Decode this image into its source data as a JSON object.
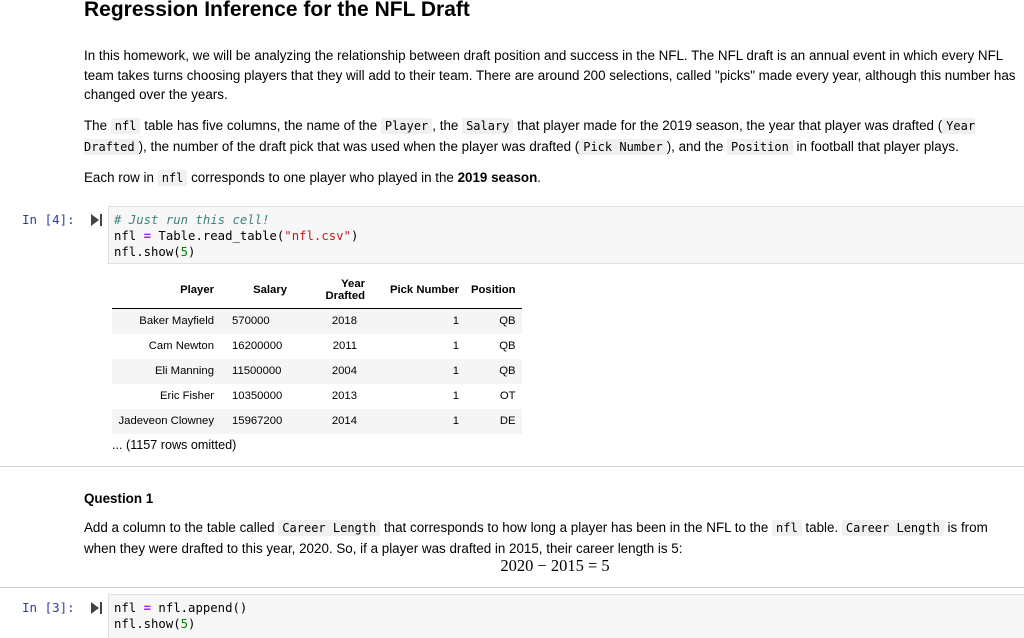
{
  "title": "Regression Inference for the NFL Draft",
  "intro": "In this homework, we will be analyzing the relationship between draft position and success in the NFL. The NFL draft is an annual event in which every NFL team takes turns choosing players that they will add to their team. There are around 200 selections, called \"picks\" made every year, although this number has changed over the years.",
  "para2": {
    "t1": "The ",
    "c1": "nfl",
    "t2": " table has five columns, the name of the ",
    "c2": "Player",
    "t3": ", the ",
    "c3": "Salary",
    "t4": " that player made for the 2019 season, the year that player was drafted (",
    "c4": "Year Drafted",
    "t5": "), the number of the draft pick that was used when the player was drafted (",
    "c5": "Pick Number",
    "t6": "), and the ",
    "c6": "Position",
    "t7": " in football that player plays."
  },
  "para3": {
    "t1": "Each row in ",
    "c1": "nfl",
    "t2": " corresponds to one player who played in the ",
    "b1": "2019 season",
    "t3": "."
  },
  "cell1": {
    "prompt": "In [4]:",
    "line1": "# Just run this cell!",
    "line2a": "nfl ",
    "line2op": "=",
    "line2b": " Table.read_table(",
    "line2str": "\"nfl.csv\"",
    "line2c": ")",
    "line3a": "nfl.show(",
    "line3num": "5",
    "line3b": ")"
  },
  "table": {
    "headers": [
      "Player",
      "Salary",
      "Year Drafted",
      "Pick Number",
      "Position"
    ],
    "rows": [
      [
        "Baker Mayfield",
        "570000",
        "2018",
        "1",
        "QB"
      ],
      [
        "Cam Newton",
        "16200000",
        "2011",
        "1",
        "QB"
      ],
      [
        "Eli Manning",
        "11500000",
        "2004",
        "1",
        "QB"
      ],
      [
        "Eric Fisher",
        "10350000",
        "2013",
        "1",
        "OT"
      ],
      [
        "Jadeveon Clowney",
        "15967200",
        "2014",
        "1",
        "DE"
      ]
    ],
    "omitted": "... (1157 rows omitted)"
  },
  "question1": {
    "heading": "Question 1",
    "t1": "Add a column to the table called ",
    "c1": "Career Length",
    "t2": " that corresponds to how long a player has been in the NFL to the ",
    "c2": "nfl",
    "t3": " table. ",
    "c3": "Career Length",
    "t4": " is from when they were drafted to this year, 2020. So, if a player was drafted in 2015, their career length is 5:",
    "math": "2020 − 2015 = 5"
  },
  "cell2": {
    "prompt": "In [3]:",
    "line1a": "nfl ",
    "line1op": "=",
    "line1b": " nfl.append()",
    "line2a": "nfl.show(",
    "line2num": "5",
    "line2b": ")"
  }
}
